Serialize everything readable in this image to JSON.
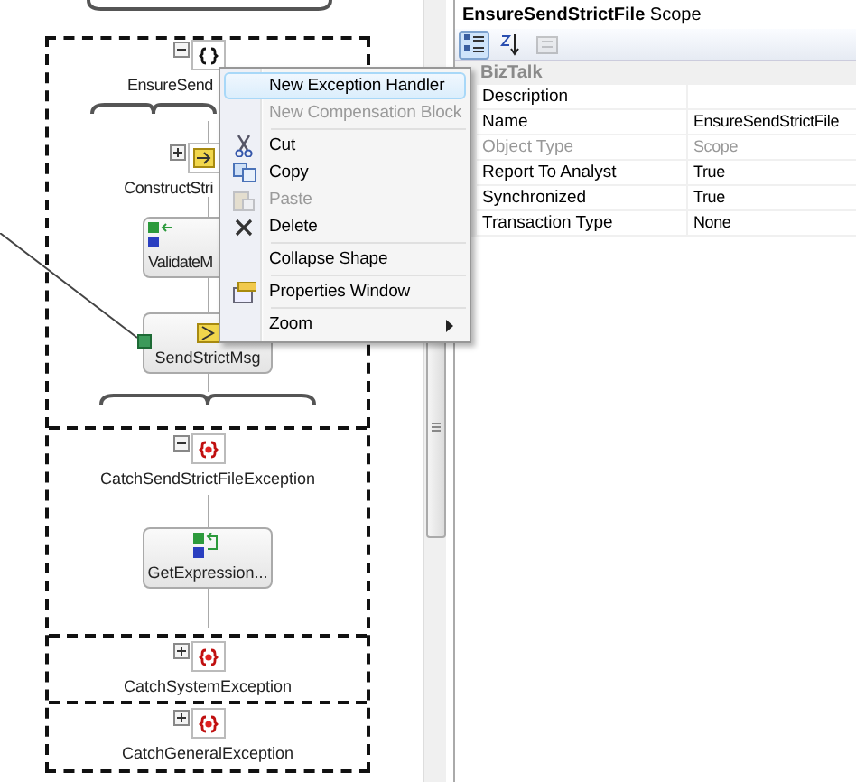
{
  "designer": {
    "scope": {
      "label": "EnsureSend",
      "expanded": true
    },
    "steps": [
      {
        "kind": "construct",
        "label": "ConstructStri",
        "expanded": false
      },
      {
        "kind": "transform",
        "label": "ValidateM"
      },
      {
        "kind": "send",
        "label": "SendStrictMsg"
      }
    ],
    "handlers": [
      {
        "label": "CatchSendStrictFileException",
        "expanded": true,
        "steps": [
          {
            "kind": "expression",
            "label": "GetExpression..."
          }
        ]
      },
      {
        "label": "CatchSystemException",
        "expanded": false
      },
      {
        "label": "CatchGeneralException",
        "expanded": false
      }
    ]
  },
  "context_menu": {
    "groups": [
      [
        {
          "label": "New Exception Handler",
          "selected": true,
          "disabled": false
        },
        {
          "label": "New Compensation Block",
          "selected": false,
          "disabled": true
        }
      ],
      [
        {
          "label": "Cut",
          "selected": false,
          "disabled": false
        },
        {
          "label": "Copy",
          "selected": false,
          "disabled": false
        },
        {
          "label": "Paste",
          "selected": false,
          "disabled": true
        },
        {
          "label": "Delete",
          "selected": false,
          "disabled": false
        }
      ],
      [
        {
          "label": "Collapse Shape",
          "selected": false,
          "disabled": false
        }
      ],
      [
        {
          "label": "Properties Window",
          "selected": false,
          "disabled": false
        }
      ],
      [
        {
          "label": "Zoom",
          "selected": false,
          "disabled": false,
          "has_submenu": true
        }
      ]
    ]
  },
  "properties": {
    "title": "**EnsureSendStrictFile** Scope",
    "toolbar": [
      {
        "selected": true,
        "disabled": false
      },
      {
        "selected": false,
        "disabled": false
      },
      {
        "selected": false,
        "disabled": true
      }
    ],
    "category": {
      "label": "BizTalk"
    },
    "rows": [
      {
        "name": "Description",
        "value": "",
        "disabled": false
      },
      {
        "name": "Name",
        "value": "EnsureSendStrictFile",
        "disabled": false
      },
      {
        "name": "Object Type",
        "value": "Scope",
        "disabled": true
      },
      {
        "name": "Report To Analyst",
        "value": "True",
        "disabled": false
      },
      {
        "name": "Synchronized",
        "value": "True",
        "disabled": false
      },
      {
        "name": "Transaction Type",
        "value": "None",
        "disabled": false
      }
    ]
  }
}
